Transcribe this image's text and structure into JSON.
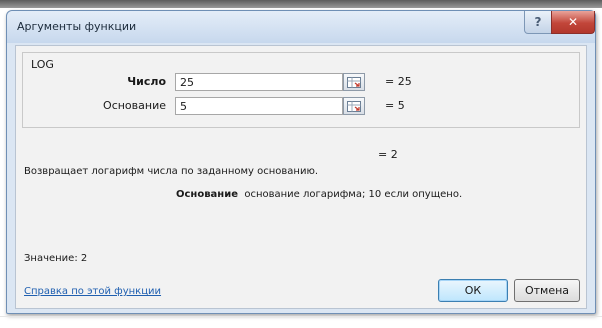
{
  "window": {
    "title": "Аргументы функции",
    "help_glyph": "?",
    "close_glyph": "✕"
  },
  "function": {
    "name": "LOG",
    "args": [
      {
        "label": "Число",
        "value": "25",
        "result": "= 25",
        "bold": true
      },
      {
        "label": "Основание",
        "value": "5",
        "result": "= 5",
        "bold": false
      }
    ],
    "result_preview": "= 2",
    "description": "Возвращает логарифм числа по заданному основанию.",
    "arg_help_name": "Основание",
    "arg_help_text": "основание логарифма; 10 если опущено."
  },
  "footer": {
    "result_label": "Значение:",
    "result_value": "2",
    "help_link": "Справка по этой функции",
    "ok_label": "ОК",
    "cancel_label": "Отмена"
  },
  "colors": {
    "window_frame": "#dbe6f3",
    "close_button": "#c2463a",
    "link": "#1f5fb0"
  },
  "icons": [
    "help-icon",
    "close-icon",
    "range-selector-icon"
  ]
}
